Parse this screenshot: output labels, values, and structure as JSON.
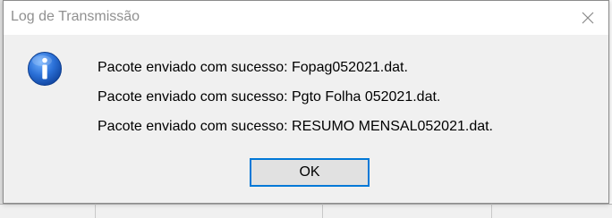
{
  "dialog": {
    "title": "Log de Transmissão",
    "close_icon": "close-icon",
    "message_icon": "information-icon",
    "messages": [
      "Pacote enviado com sucesso: Fopag052021.dat.",
      "Pacote enviado com sucesso: Pgto Folha 052021.dat.",
      "Pacote enviado com sucesso: RESUMO MENSAL052021.dat."
    ],
    "ok_label": "OK"
  },
  "colors": {
    "accent": "#0078d7",
    "icon_blue": "#1a5fc4",
    "dialog_bg": "#f0f0f0",
    "titlebar_bg": "#ffffff"
  }
}
